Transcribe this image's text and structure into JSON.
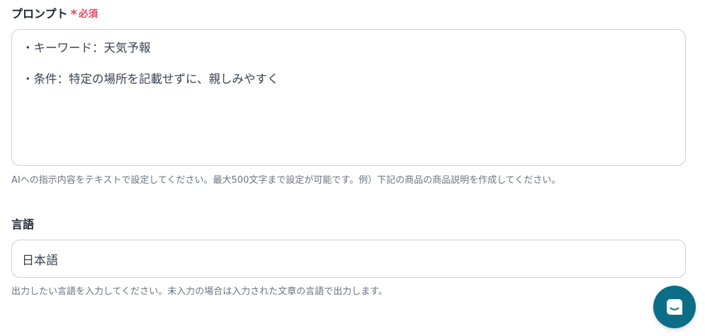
{
  "prompt": {
    "label": "プロンプト",
    "required_mark": "*",
    "required_text": "必須",
    "lines": [
      "・キーワード：天気予報",
      "・条件：特定の場所を記載せずに、親しみやすく"
    ],
    "helper": "AIへの指示内容をテキストで設定してください。最大500文字まで設定が可能です。例）下記の商品の商品説明を作成してください。"
  },
  "language": {
    "label": "言語",
    "value": "日本語",
    "helper": "出力したい言語を入力してください。未入力の場合は入力された文章の言語で出力します。"
  },
  "chat_launcher": {
    "icon": "chat-icon",
    "color": "#0b6e86"
  }
}
